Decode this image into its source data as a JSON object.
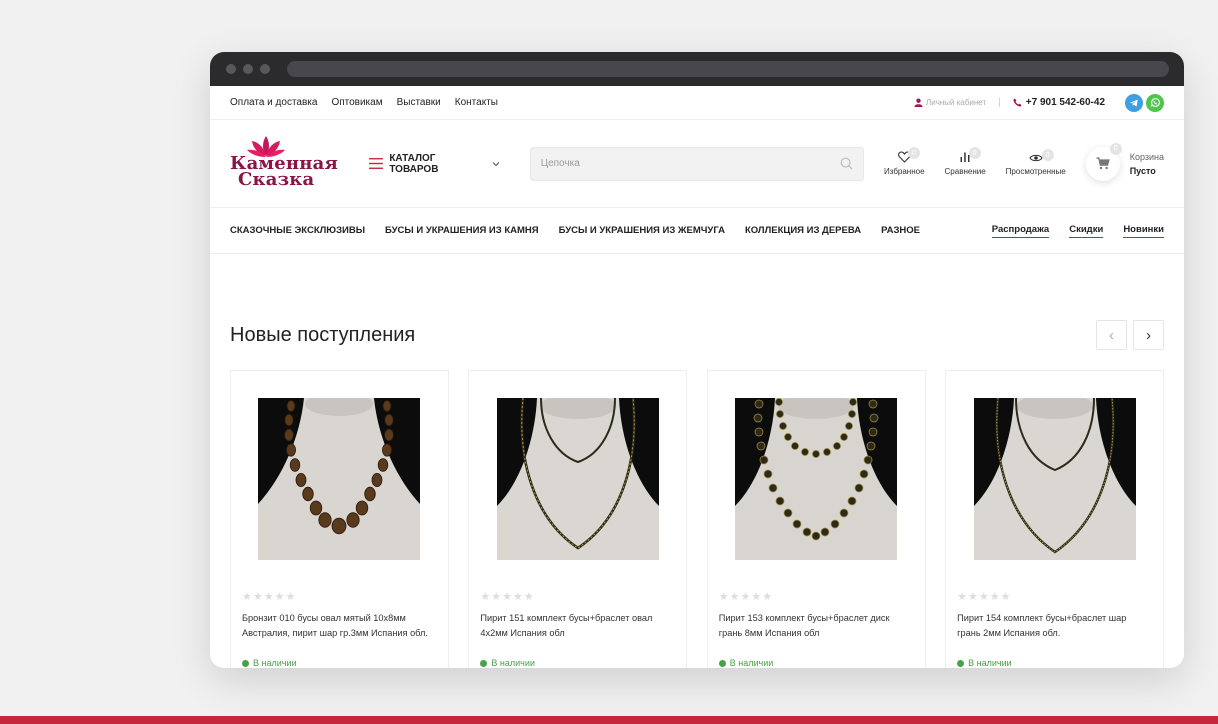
{
  "topbar": {
    "links": [
      "Оплата и доставка",
      "Оптовикам",
      "Выставки",
      "Контакты"
    ],
    "cabinet": "Личный кабинет",
    "separator": "|",
    "phone": "+7 901 542-60-42"
  },
  "header": {
    "logo_line1": "Каменная",
    "logo_line2": "Сказка",
    "catalog_label": "КАТАЛОГ ТОВАРОВ",
    "search_placeholder": "Цепочка",
    "icons": {
      "favorites": {
        "label": "Избранное",
        "count": "0"
      },
      "compare": {
        "label": "Сравнение",
        "count": "0"
      },
      "viewed": {
        "label": "Просмотренные",
        "count": "0"
      }
    },
    "cart": {
      "label": "Корзина",
      "status": "Пусто",
      "count": "0"
    }
  },
  "nav": {
    "items": [
      "СКАЗОЧНЫЕ ЭКСКЛЮЗИВЫ",
      "БУСЫ И УКРАШЕНИЯ ИЗ КАМНЯ",
      "БУСЫ И УКРАШЕНИЯ ИЗ ЖЕМЧУГА",
      "КОЛЛЕКЦИЯ ИЗ ДЕРЕВА",
      "РАЗНОЕ"
    ],
    "promos": [
      "Распродажа",
      "Скидки",
      "Новинки"
    ]
  },
  "section": {
    "title": "Новые поступления",
    "prev": "‹",
    "next": "›"
  },
  "products": [
    {
      "name": "Бронзит 010 бусы овал мятый 10х8мм Австралия, пирит шар гр.3мм Испания обл.",
      "stock": "В наличии",
      "rating": 0
    },
    {
      "name": "Пирит 151 комплект бусы+браслет овал 4х2мм Испания обл",
      "stock": "В наличии",
      "rating": 0
    },
    {
      "name": "Пирит 153 комплект бусы+браслет диск грань 8мм Испания обл",
      "stock": "В наличии",
      "rating": 0
    },
    {
      "name": "Пирит 154 комплект бусы+браслет шар грань 2мм Испания обл.",
      "stock": "В наличии",
      "rating": 0
    }
  ],
  "colors": {
    "brand": "#8a1547",
    "accent": "#c5283d",
    "in_stock": "#49a14a"
  }
}
